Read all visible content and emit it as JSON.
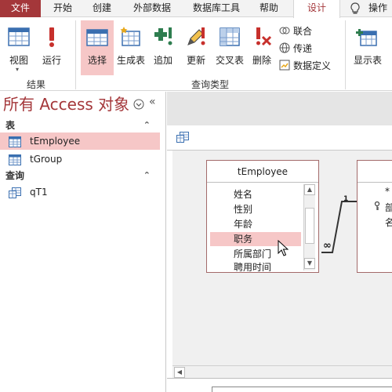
{
  "tabs": [
    {
      "label": "文件"
    },
    {
      "label": "开始"
    },
    {
      "label": "创建"
    },
    {
      "label": "外部数据"
    },
    {
      "label": "数据库工具"
    },
    {
      "label": "帮助"
    },
    {
      "label": "设计"
    },
    {
      "label": "操作"
    }
  ],
  "ribbon": {
    "groups": {
      "results": "结果",
      "query_type": "查询类型"
    },
    "buttons": {
      "view": "视图",
      "run": "运行",
      "select": "选择",
      "make_table": "生成表",
      "append": "追加",
      "update": "更新",
      "crosstab": "交叉表",
      "delete": "删除",
      "union": "联合",
      "passthrough": "传递",
      "data_definition": "数据定义",
      "show_table": "显示表"
    }
  },
  "nav": {
    "title": "所有 Access 对象",
    "sections": [
      {
        "label": "表",
        "items": [
          "tEmployee",
          "tGroup"
        ]
      },
      {
        "label": "查询",
        "items": [
          "qT1"
        ]
      }
    ]
  },
  "design": {
    "table1": {
      "name": "tEmployee",
      "fields": [
        "姓名",
        "性别",
        "年龄",
        "职务",
        "所属部门",
        "聘用时间"
      ]
    },
    "table2": {
      "fields": [
        "*",
        "部",
        "名"
      ]
    },
    "relationship": {
      "one": "1",
      "many": "∞"
    }
  }
}
